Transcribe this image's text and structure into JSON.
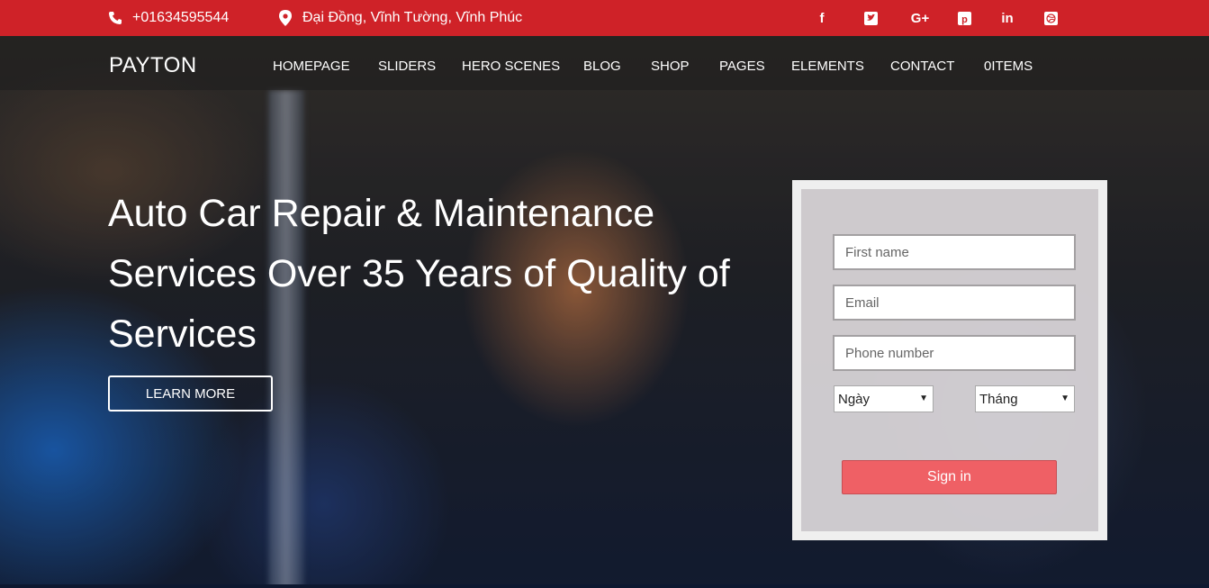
{
  "topbar": {
    "phone": "+01634595544",
    "address": "Đại Đồng, Vĩnh Tường, Vĩnh Phúc",
    "social": [
      {
        "icon": "facebook-icon",
        "glyph": "f"
      },
      {
        "icon": "twitter-icon",
        "glyph": "t"
      },
      {
        "icon": "google-plus-icon",
        "glyph": "G+"
      },
      {
        "icon": "pinterest-icon",
        "glyph": "p"
      },
      {
        "icon": "linkedin-icon",
        "glyph": "in"
      },
      {
        "icon": "dribbble-icon",
        "glyph": "⊛"
      }
    ],
    "color": "#cf2228"
  },
  "nav": {
    "logo": "PAYTON",
    "items": [
      "HOMEPAGE",
      "SLIDERS",
      "HERO SCENES",
      "BLOG",
      "SHOP",
      "PAGES",
      "ELEMENTS",
      "CONTACT",
      "0ITEMS"
    ]
  },
  "hero": {
    "headline": "Auto Car Repair & Maintenance Services Over 35 Years of Quality of Services",
    "cta": "LEARN MORE"
  },
  "form": {
    "first_name_placeholder": "First name",
    "email_placeholder": "Email",
    "phone_placeholder": "Phone number",
    "day_select": "Ngày",
    "month_select": "Tháng",
    "submit": "Sign in",
    "accent": "#ef6065"
  }
}
